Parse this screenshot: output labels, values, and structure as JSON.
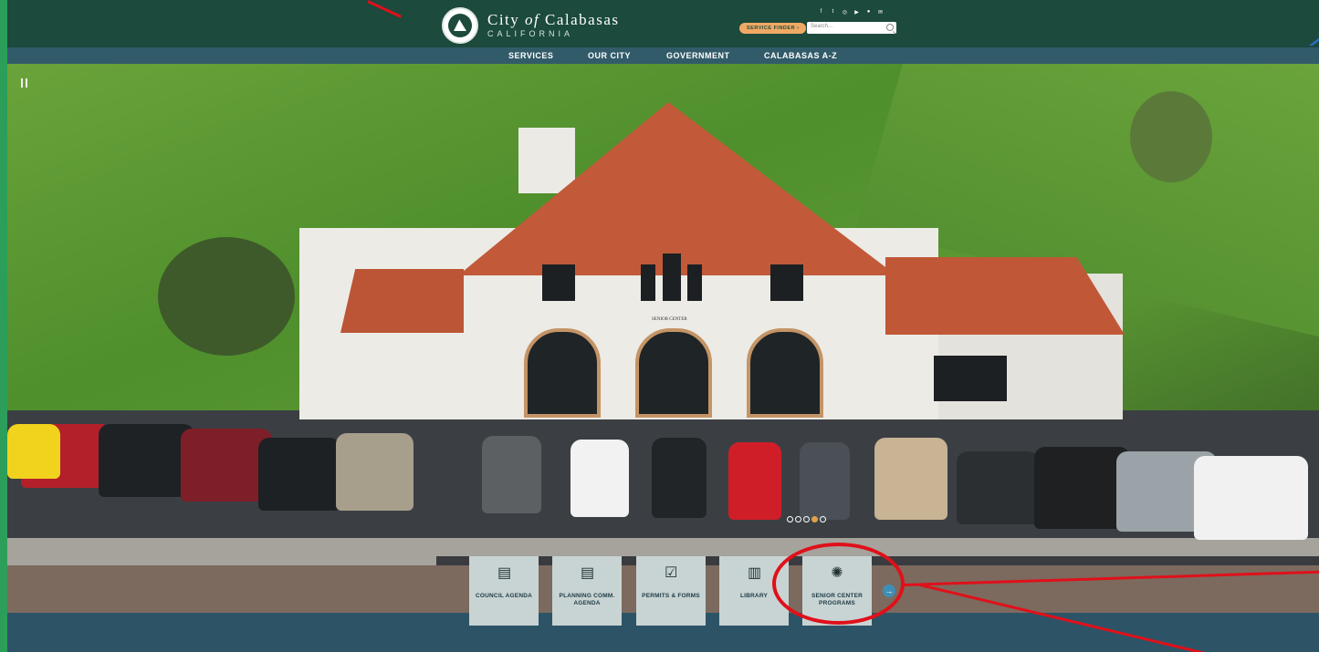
{
  "header": {
    "logo_title_pre": "City ",
    "logo_title_of": "of",
    "logo_title_post": " Calabasas",
    "logo_subtitle": "CALIFORNIA",
    "service_finder": "SERVICE FINDER ›",
    "search_placeholder": "Search..."
  },
  "social_icons": [
    "facebook-icon",
    "twitter-icon",
    "instagram-icon",
    "youtube-icon",
    "rss-icon",
    "email-icon"
  ],
  "nav": {
    "items": [
      {
        "label": "SERVICES"
      },
      {
        "label": "OUR CITY"
      },
      {
        "label": "GOVERNMENT"
      },
      {
        "label": "CALABASAS A-Z"
      }
    ]
  },
  "hero": {
    "sign": "SENIOR CENTER",
    "slide_count": 5,
    "active_slide": 3
  },
  "tiles": [
    {
      "label": "COUNCIL AGENDA",
      "icon": "document-icon"
    },
    {
      "label": "PLANNING COMM. AGENDA",
      "icon": "document-icon"
    },
    {
      "label": "PERMITS & FORMS",
      "icon": "clipboard-icon"
    },
    {
      "label": "LIBRARY",
      "icon": "book-icon"
    },
    {
      "label": "SENIOR CENTER PROGRAMS",
      "icon": "gear-people-icon"
    }
  ],
  "colors": {
    "brand_green": "#1c4a3c",
    "nav_blue": "#325b6a",
    "accent_orange": "#f0a964",
    "annotation_red": "#e0101a"
  }
}
